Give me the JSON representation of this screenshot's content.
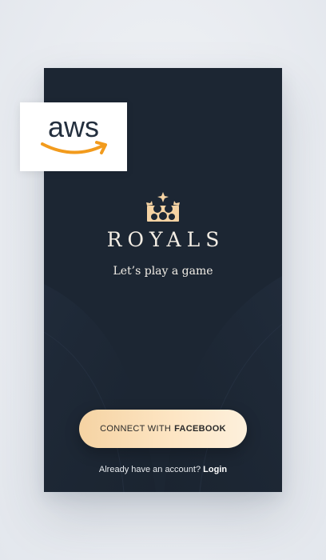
{
  "app": {
    "brand_name": "ROYALS",
    "tagline": "Let’s play a game",
    "logo_icon": "crown-icon"
  },
  "overlay": {
    "badge_text": "aws",
    "badge_icon": "aws-smile-arrow-icon"
  },
  "actions": {
    "connect_prefix": "CONNECT WITH",
    "connect_provider": "FACEBOOK",
    "account_prompt": "Already have an account?",
    "login_label": "Login"
  },
  "colors": {
    "background": "#1c2633",
    "accent_gold": "#f5d3a3",
    "aws_orange": "#f29b1d",
    "aws_text": "#232f3e"
  }
}
